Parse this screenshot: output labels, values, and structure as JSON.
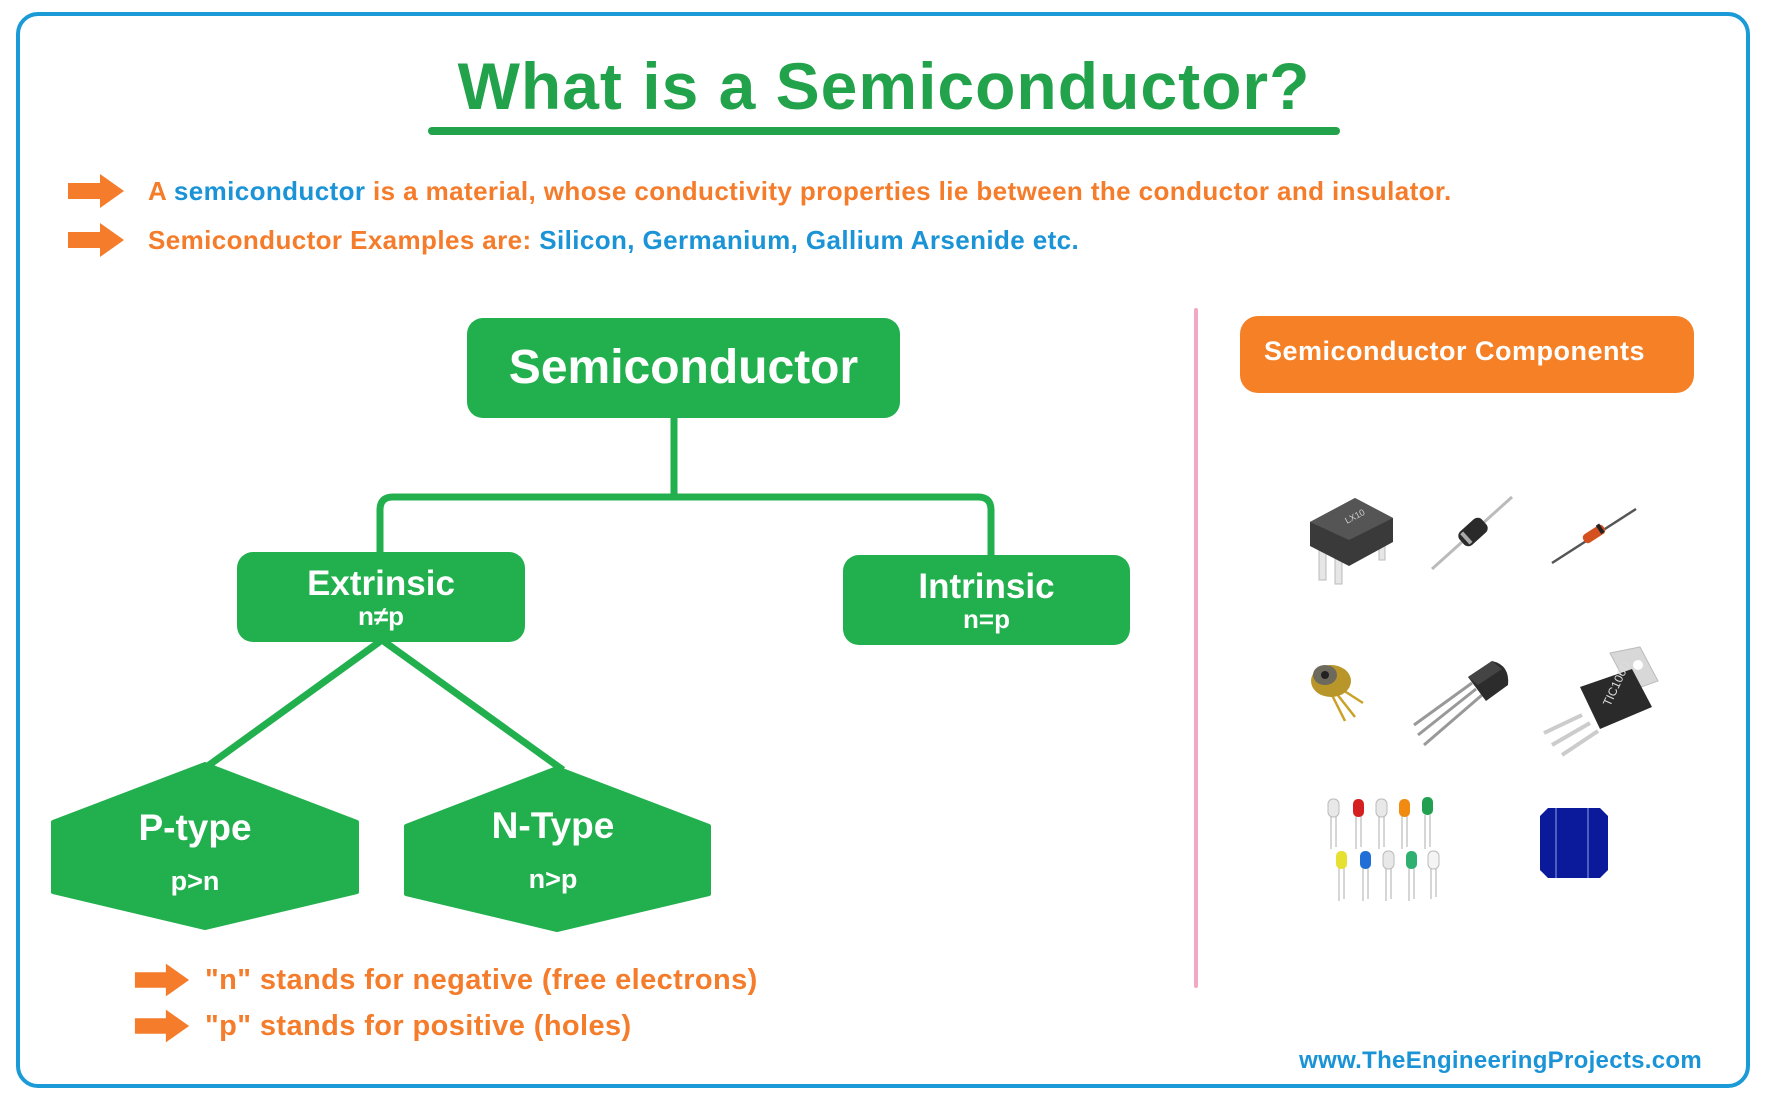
{
  "title": "What is a Semiconductor?",
  "colors": {
    "frame": "#1a9ad6",
    "green": "#22b04e",
    "orange": "#f47c2a",
    "blue": "#1a94d6",
    "divider": "#f3a7c4"
  },
  "bullets_top": [
    {
      "icon": "arrow-right-icon",
      "parts": [
        {
          "text": "A ",
          "style": "orange"
        },
        {
          "text": "semiconductor",
          "style": "blue"
        },
        {
          "text": " is a material, whose conductivity properties lie between the conductor and insulator.",
          "style": "orange"
        }
      ]
    },
    {
      "icon": "arrow-right-icon",
      "parts": [
        {
          "text": "Semiconductor Examples are: ",
          "style": "orange"
        },
        {
          "text": "Silicon, Germanium, Gallium Arsenide etc.",
          "style": "blue"
        }
      ]
    }
  ],
  "tree": {
    "root": "Semiconductor",
    "extrinsic": {
      "title": "Extrinsic",
      "relation": "n≠p"
    },
    "intrinsic": {
      "title": "Intrinsic",
      "relation": "n=p"
    },
    "p_type": {
      "title": "P-type",
      "relation": "p>n"
    },
    "n_type": {
      "title": "N-Type",
      "relation": "n>p"
    }
  },
  "bullets_bottom": [
    {
      "icon": "arrow-right-icon",
      "text": "\"n\" stands for negative (free electrons)"
    },
    {
      "icon": "arrow-right-icon",
      "text": "\"p\" stands for positive (holes)"
    }
  ],
  "components": {
    "heading": "Semiconductor Components",
    "items": [
      "optocoupler-icon",
      "diode-icon",
      "zener-diode-icon",
      "laser-diode-icon",
      "transistor-icon",
      "thyristor-icon",
      "led-set-icon",
      "solar-cell-icon"
    ]
  },
  "footer": {
    "url": "www.TheEngineeringProjects.com"
  }
}
